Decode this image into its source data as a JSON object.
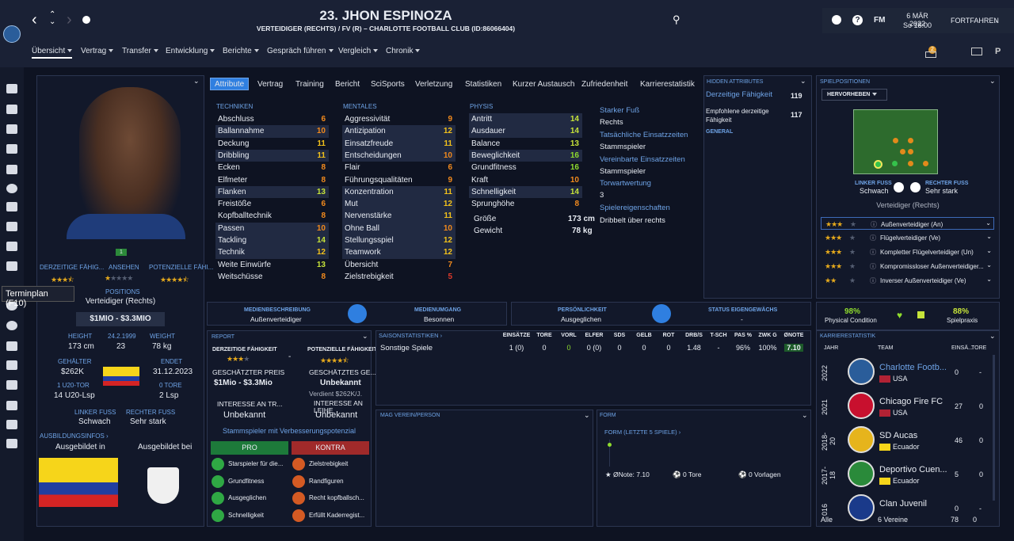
{
  "header": {
    "title": "23. JHON ESPINOZA",
    "subtitle": "VERTEIDIGER (RECHTS) / FV (R) – CHARLOTTE FOOTBALL CLUB (ID:86066404)",
    "date": "6 MÄR 2022",
    "time": "So 18:00",
    "continue": "FORTFAHREN",
    "fm": "FM",
    "badge": "2"
  },
  "menu": [
    "Übersicht",
    "Vertrag",
    "Transfer",
    "Entwicklung",
    "Berichte",
    "Gespräch führen",
    "Vergleich",
    "Chronik"
  ],
  "tabs": [
    "Attribute",
    "Vertrag",
    "Training",
    "Bericht",
    "SciSports",
    "Verletzung",
    "Statistiken",
    "Kurzer Austausch",
    "Zufriedenheit",
    "Karrierestatistik"
  ],
  "tooltip": "Terminplan (F10)",
  "profile": {
    "hdr_ca": "DERZEITIGE FÄHIG...",
    "hdr_rep": "ANSEHEN",
    "hdr_pa": "POTENZIELLE FÄHI...",
    "ca_stars": "★★★",
    "pa_stars": "★★★★",
    "pos_label": "POSITIONS",
    "pos_value": "Verteidiger (Rechts)",
    "value": "$1MIO - $3.3MIO",
    "height_lbl": "HEIGHT",
    "height": "173 cm",
    "dob": "24.2.1999",
    "age": "23",
    "weight_lbl": "WEIGHT",
    "weight": "78 kg",
    "wage_lbl": "GEHÄLTER",
    "wage": "$262K",
    "end_lbl": "ENDET",
    "end": "31.12.2023",
    "u20_lbl": "1 U20-TOR",
    "u20": "14 U20-Lsp",
    "goals_lbl": "0 TORE",
    "caps": "2 Lsp",
    "lf_lbl": "LINKER FUSS",
    "lf": "Schwach",
    "rf_lbl": "RECHTER FUSS",
    "rf": "Sehr stark",
    "train_hdr": "AUSBILDUNGSINFOS ›",
    "train_in": "Ausgebildet in",
    "train_at": "Ausgebildet bei",
    "shirt": "1"
  },
  "attr": {
    "tech_hdr": "TECHNIKEN",
    "ment_hdr": "MENTALES",
    "phys_hdr": "PHYSIS",
    "tech": [
      [
        "Abschluss",
        "6"
      ],
      [
        "Ballannahme",
        "10"
      ],
      [
        "Deckung",
        "11"
      ],
      [
        "Dribbling",
        "11"
      ],
      [
        "Ecken",
        "8"
      ],
      [
        "Elfmeter",
        "8"
      ],
      [
        "Flanken",
        "13"
      ],
      [
        "Freistöße",
        "6"
      ],
      [
        "Kopfballtechnik",
        "8"
      ],
      [
        "Passen",
        "10"
      ],
      [
        "Tackling",
        "14"
      ],
      [
        "Technik",
        "12"
      ],
      [
        "Weite Einwürfe",
        "13"
      ],
      [
        "Weitschüsse",
        "8"
      ]
    ],
    "ment": [
      [
        "Aggressivität",
        "9"
      ],
      [
        "Antizipation",
        "12"
      ],
      [
        "Einsatzfreude",
        "11"
      ],
      [
        "Entscheidungen",
        "10"
      ],
      [
        "Flair",
        "6"
      ],
      [
        "Führungsqualitäten",
        "9"
      ],
      [
        "Konzentration",
        "11"
      ],
      [
        "Mut",
        "12"
      ],
      [
        "Nervenstärke",
        "11"
      ],
      [
        "Ohne Ball",
        "10"
      ],
      [
        "Stellungsspiel",
        "12"
      ],
      [
        "Teamwork",
        "12"
      ],
      [
        "Übersicht",
        "7"
      ],
      [
        "Zielstrebigkeit",
        "5"
      ]
    ],
    "phys": [
      [
        "Antritt",
        "14"
      ],
      [
        "Ausdauer",
        "14"
      ],
      [
        "Balance",
        "13"
      ],
      [
        "Beweglichkeit",
        "16"
      ],
      [
        "Grundfitness",
        "16"
      ],
      [
        "Kraft",
        "10"
      ],
      [
        "Schnelligkeit",
        "14"
      ],
      [
        "Sprunghöhe",
        "8"
      ]
    ],
    "size_lbl": "Größe",
    "size": "173 cm",
    "weight_lbl": "Gewicht",
    "weight": "78 kg",
    "foot_lbl": "Starker Fuß",
    "foot": "Rechts",
    "actual_lbl": "Tatsächliche Einsatzzeiten",
    "actual": "Stammspieler",
    "agreed_lbl": "Vereinbarte Einsatzzeiten",
    "agreed": "Stammspieler",
    "goal_lbl": "Torwartwertung",
    "goal": "3",
    "traits_lbl": "Spielereigenschaften",
    "traits": "Dribbelt über rechts"
  },
  "hidden": {
    "hdr": "HIDDEN ATTRIBUTES",
    "ca_lbl": "Derzeitige Fähigkeit",
    "ca": "119",
    "rec_lbl": "Empfohlene derzeitige Fähigkeit",
    "rec": "117",
    "general": "GENERAL"
  },
  "positions": {
    "hdr": "SPIELPOSITIONEN",
    "select": "HERVORHEBEN",
    "lf_lbl": "LINKER FUSS",
    "lf": "Schwach",
    "rf_lbl": "RECHTER FUSS",
    "rf": "Sehr stark",
    "role": "Verteidiger (Rechts)",
    "roles": [
      [
        "★★★",
        "Außenverteidiger (An)"
      ],
      [
        "★★★",
        "Flügelverteidiger (Ve)"
      ],
      [
        "★★★",
        "Kompletter Flügelverteidiger (Un)"
      ],
      [
        "★★★",
        "Kompromissloser Außenverteidiger..."
      ],
      [
        "★★",
        "Inverser Außenverteidiger (Ve)"
      ]
    ],
    "pc_pct": "98%",
    "pc_lbl": "Physical Condition",
    "mp_pct": "88%",
    "mp_lbl": "Spielpraxis"
  },
  "media": {
    "desc_lbl": "MEDIENBESCHREIBUNG",
    "desc": "Außenverteidiger",
    "handling_lbl": "MEDIENUMGANG",
    "handling": "Besonnen",
    "pers_lbl": "PERSÖNLICHKEIT",
    "pers": "Ausgeglichen",
    "status_lbl": "STATUS EIGENGEWÄCHS",
    "status": "-"
  },
  "report": {
    "hdr": "REPORT",
    "ca_lbl": "DERZEITIGE FÄHIGKEIT",
    "pa_lbl": "POTENZIELLE FÄHIGKEIT",
    "dash": "-",
    "est_lbl": "GESCHÄTZTER PREIS",
    "est": "$1Mio - $3.3Mio",
    "est2_lbl": "GESCHÄTZTES GE...",
    "est2": "Unbekannt",
    "earn": "Verdient $262K/J.",
    "int_lbl": "INTERESSE AN TR...",
    "int": "Unbekannt",
    "int2_lbl": "INTERESSE AN LEIHE",
    "int2": "Unbekannt",
    "summary": "Stammspieler mit Verbesserungspotenzial",
    "pro": "PRO",
    "con": "KONTRA",
    "pros": [
      "Starspieler für die...",
      "Grundfitness",
      "Ausgeglichen",
      "Schnelligkeit"
    ],
    "cons": [
      "Zielstrebigkeit",
      "Randfiguren",
      "Recht kopfballsch...",
      "Erfüllt Kaderregist..."
    ]
  },
  "season": {
    "hdr": "SAISONSTATISTIKEN ›",
    "cols": [
      "EINSÄTZE",
      "TORE",
      "VORL",
      "ELFER",
      "SDS",
      "GELB",
      "ROT",
      "DRB/S",
      "T-SCH",
      "PAS %",
      "ZWK G",
      "ØNOTE"
    ],
    "row_lbl": "Sonstige Spiele",
    "row": [
      "1 (0)",
      "0",
      "0",
      "0 (0)",
      "0",
      "0",
      "0",
      "1.48",
      "-",
      "96%",
      "100%",
      "7.10"
    ]
  },
  "mag": {
    "hdr": "MAG VEREIN/PERSON"
  },
  "form": {
    "hdr": "FORM",
    "sub": "FORM (LETZTE 5 SPIELE) ›",
    "avg": "ØNote: 7.10",
    "goals": "0 Tore",
    "assists": "0 Vorlagen"
  },
  "career": {
    "hdr": "KARRIERESTATISTIK",
    "year_col": "JAHR",
    "team_col": "TEAM",
    "apps_col": "EINSÄ...",
    "goals_col": "TORE",
    "rows": [
      [
        "2022",
        "Charlotte Footb...",
        "USA",
        "0",
        "-"
      ],
      [
        "2021",
        "Chicago Fire FC",
        "USA",
        "27",
        "0"
      ],
      [
        "2018-20",
        "SD Aucas",
        "Ecuador",
        "46",
        "0"
      ],
      [
        "2017-18",
        "Deportivo Cuen...",
        "Ecuador",
        "5",
        "0"
      ],
      [
        "016",
        "Clan Juvenil",
        "",
        "0",
        "-"
      ]
    ],
    "total_lbl": "Alle",
    "total_clubs": "6 Vereine",
    "total_apps": "78",
    "total_goals": "0"
  },
  "colors": {
    "accent": "#2f7fe0",
    "stat_pos": "#1d7a3a",
    "stat_neg": "#a02a2a"
  }
}
